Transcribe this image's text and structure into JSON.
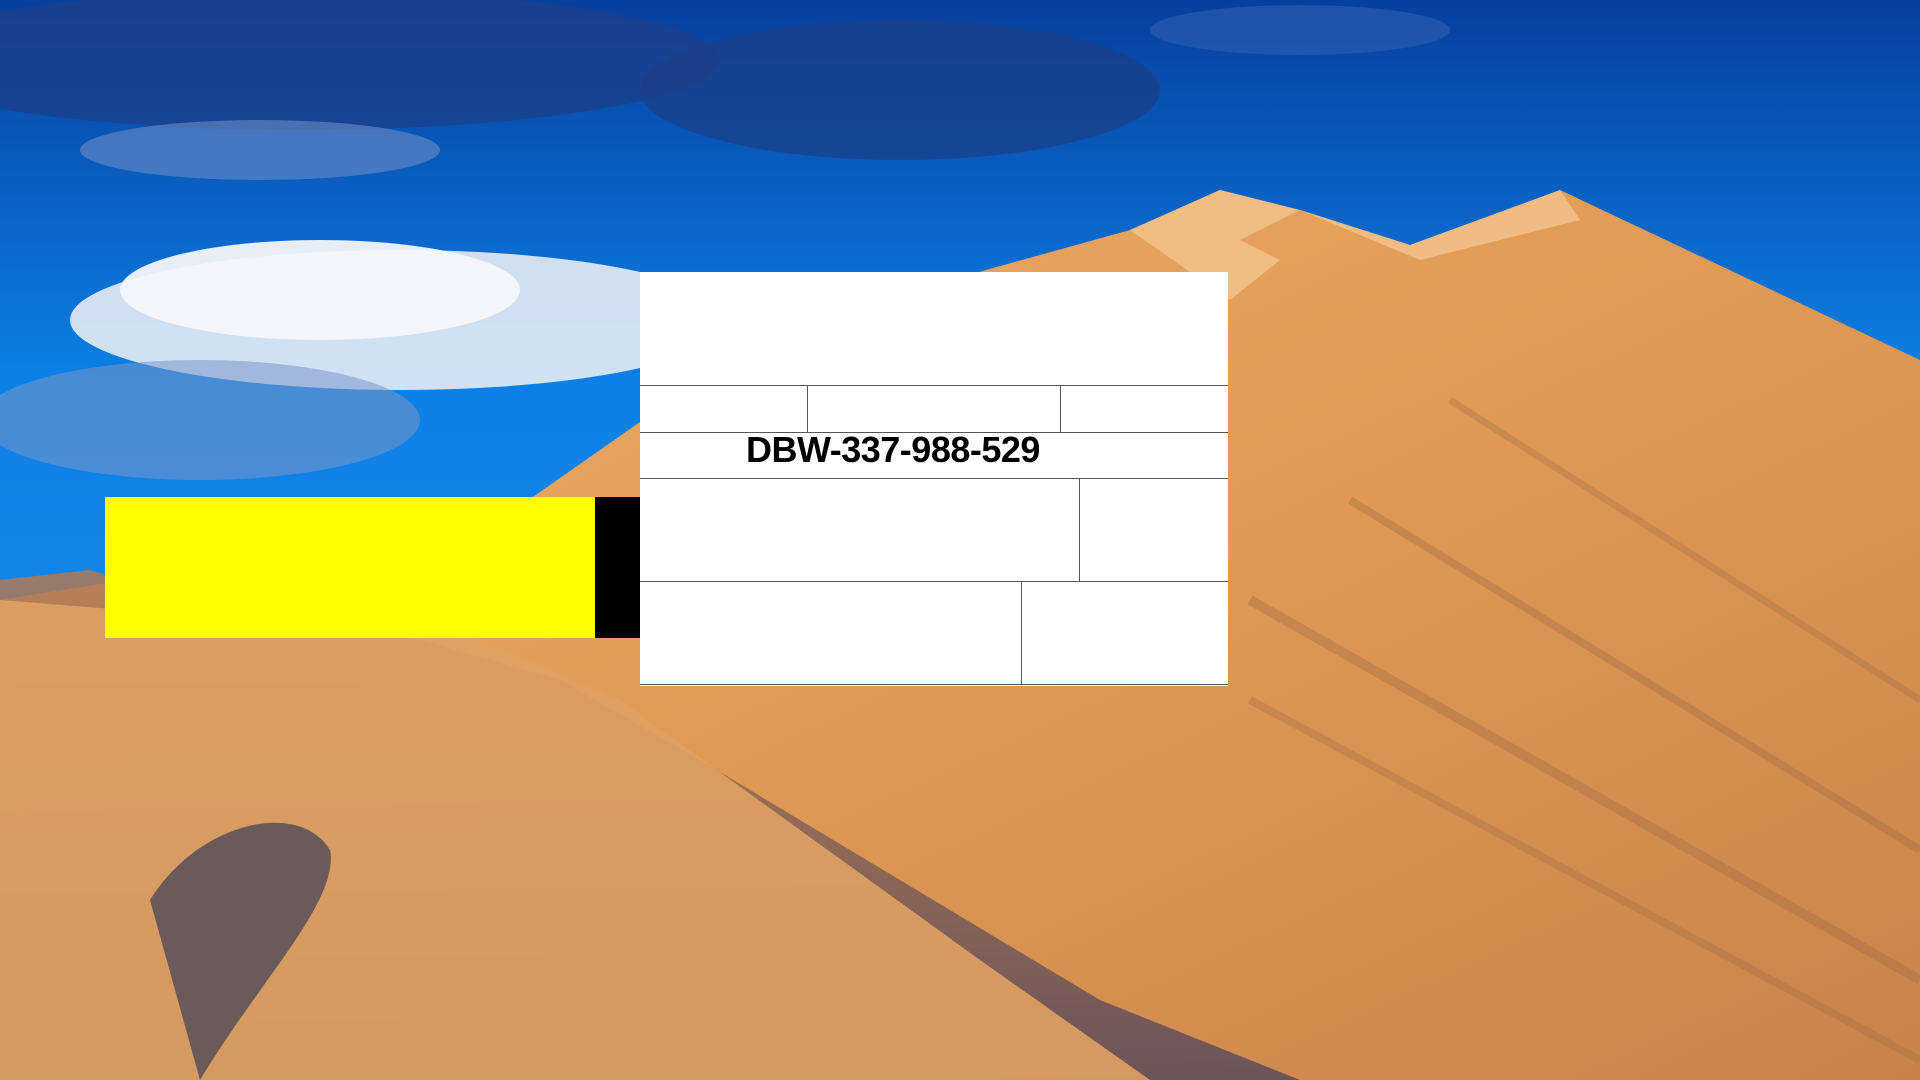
{
  "wallpaper": {
    "description_icon": "desert-dune-wallpaper",
    "sky_color": "#1a8ff0",
    "sand_color": "#e9a55c"
  },
  "overlay": {
    "yellow_color": "#ffff00",
    "black_color": "#000000"
  },
  "form": {
    "code": "DBW-337-988-529"
  }
}
